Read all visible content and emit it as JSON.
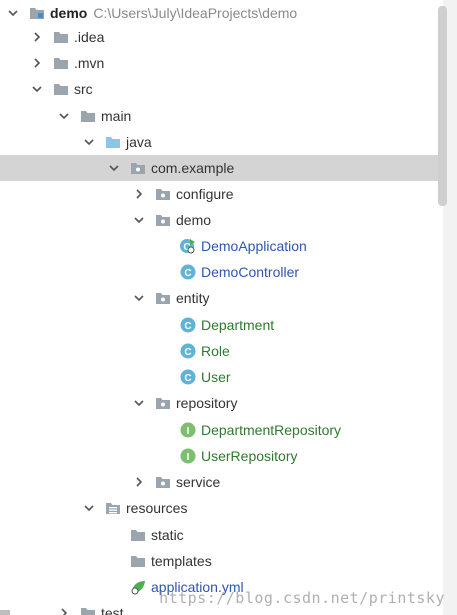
{
  "project": {
    "name": "demo",
    "path": "C:\\Users\\July\\IdeaProjects\\demo"
  },
  "tree": [
    {
      "label": "demo",
      "type": "project",
      "expanded": true
    },
    {
      "label": ".idea",
      "type": "folder-gray",
      "expanded": false
    },
    {
      "label": ".mvn",
      "type": "folder-gray",
      "expanded": false
    },
    {
      "label": "src",
      "type": "folder-gray",
      "expanded": true
    },
    {
      "label": "main",
      "type": "folder-gray",
      "expanded": true
    },
    {
      "label": "java",
      "type": "folder-blue",
      "expanded": true
    },
    {
      "label": "com.example",
      "type": "package",
      "expanded": true,
      "selected": true
    },
    {
      "label": "configure",
      "type": "package",
      "expanded": false
    },
    {
      "label": "demo",
      "type": "package",
      "expanded": true
    },
    {
      "label": "DemoApplication",
      "type": "spring-class"
    },
    {
      "label": "DemoController",
      "type": "class"
    },
    {
      "label": "entity",
      "type": "package",
      "expanded": true
    },
    {
      "label": "Department",
      "type": "entity-class"
    },
    {
      "label": "Role",
      "type": "entity-class"
    },
    {
      "label": "User",
      "type": "entity-class"
    },
    {
      "label": "repository",
      "type": "package",
      "expanded": true
    },
    {
      "label": "DepartmentRepository",
      "type": "interface"
    },
    {
      "label": "UserRepository",
      "type": "interface"
    },
    {
      "label": "service",
      "type": "package",
      "expanded": false
    },
    {
      "label": "resources",
      "type": "resources",
      "expanded": true
    },
    {
      "label": "static",
      "type": "folder-gray"
    },
    {
      "label": "templates",
      "type": "folder-gray"
    },
    {
      "label": "application.yml",
      "type": "yml"
    },
    {
      "label": "test",
      "type": "folder-gray",
      "expanded": false
    }
  ],
  "watermark": "https://blog.csdn.net/printsky",
  "colors": {
    "selection": "#d4d4d4",
    "folder_gray": "#9aa5ae",
    "folder_blue": "#87c7e8",
    "class_circle": "#5fb3d6",
    "interface_circle": "#7cbf6f",
    "spring_green": "#4caf50",
    "class_text": "#2f56b0",
    "entity_text": "#2e7a2e"
  }
}
